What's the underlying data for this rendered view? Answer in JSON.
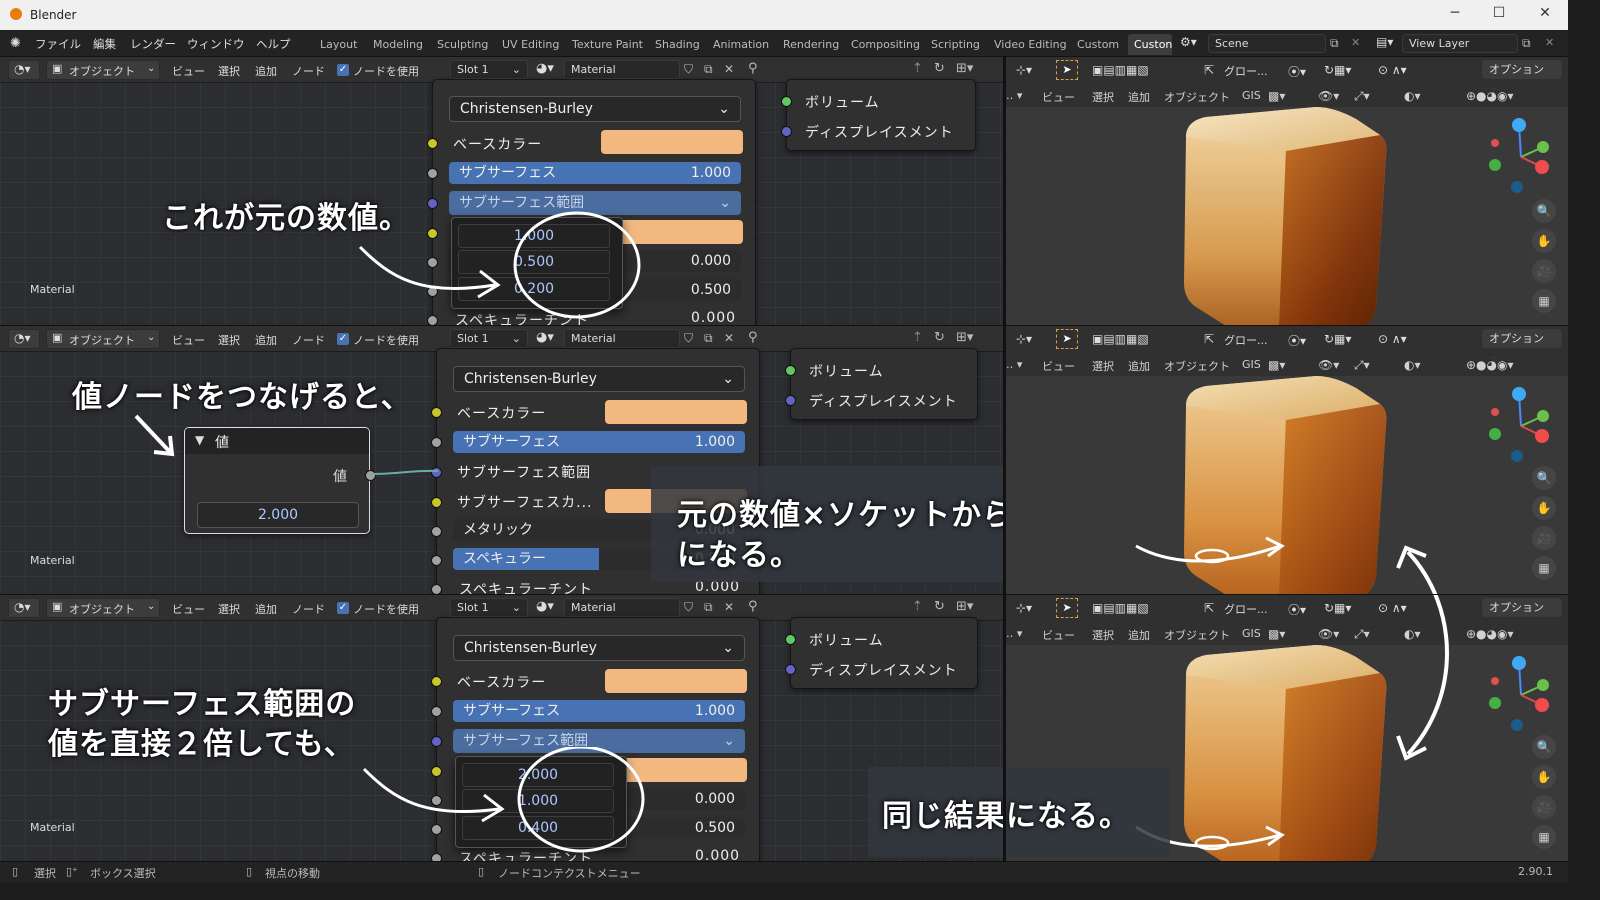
{
  "window": {
    "app_title": "Blender",
    "version": "2.90.1"
  },
  "menu": [
    "ファイル",
    "編集",
    "レンダー",
    "ウィンドウ",
    "ヘルプ"
  ],
  "workspaces": [
    "Layout",
    "Modeling",
    "Sculpting",
    "UV Editing",
    "Texture Paint",
    "Shading",
    "Animation",
    "Rendering",
    "Compositing",
    "Scripting",
    "Video Editing",
    "Custom",
    "Custon"
  ],
  "scene": "Scene",
  "view_layer": "View Layer",
  "node_header": {
    "mode": "オブジェクト",
    "view": "ビュー",
    "select": "選択",
    "add": "追加",
    "node": "ノード",
    "use_nodes": "ノードを使用",
    "slot": "Slot 1",
    "material": "Material"
  },
  "viewport_header": {
    "transform": "グロー...",
    "options": "オプション",
    "view": "ビュー",
    "select": "選択",
    "add": "追加",
    "object": "オブジェクト",
    "gis": "GIS"
  },
  "output_sockets": {
    "volume": "ボリューム",
    "displacement": "ディスプレイスメント"
  },
  "corner_label": "Material",
  "bsdf": {
    "subsurface_method": "Christensen-Burley",
    "base_color": "ベースカラー",
    "subsurface": "サブサーフェス",
    "subsurface_value": "1.000",
    "subsurface_radius": "サブサーフェス範囲",
    "subsurface_color": "サブサーフェスカ...",
    "metallic": "メタリック",
    "specular": "スペキュラー",
    "specular_tint": "スペキュラーチント",
    "metallic_value": "0.000",
    "specular_value": "0.500",
    "specular_tint_value": "0.000"
  },
  "panel1": {
    "radius": [
      "1.000",
      "0.500",
      "0.200"
    ]
  },
  "panel2": {
    "value_node_title": "値",
    "value_output": "値",
    "value": "2.000"
  },
  "panel3": {
    "radius": [
      "2.000",
      "1.000",
      "0.400"
    ]
  },
  "annotations": {
    "a1": "これが元の数値。",
    "a2": "値ノードをつなげると、",
    "a3_line1": "元の数値×ソケットからの入力値",
    "a3_line2": "になる。",
    "a4_line1": "サブサーフェス範囲の",
    "a4_line2": "値を直接２倍しても、",
    "a5": "同じ結果になる。"
  },
  "statusbar": {
    "select": "選択",
    "box_select": "ボックス選択",
    "move_view": "視点の移動",
    "context_menu": "ノードコンテクストメニュー"
  },
  "colors": {
    "accent": "#4772b3",
    "base_color_swatch": "#f2b880",
    "title_bar": "#f0f0f0"
  }
}
